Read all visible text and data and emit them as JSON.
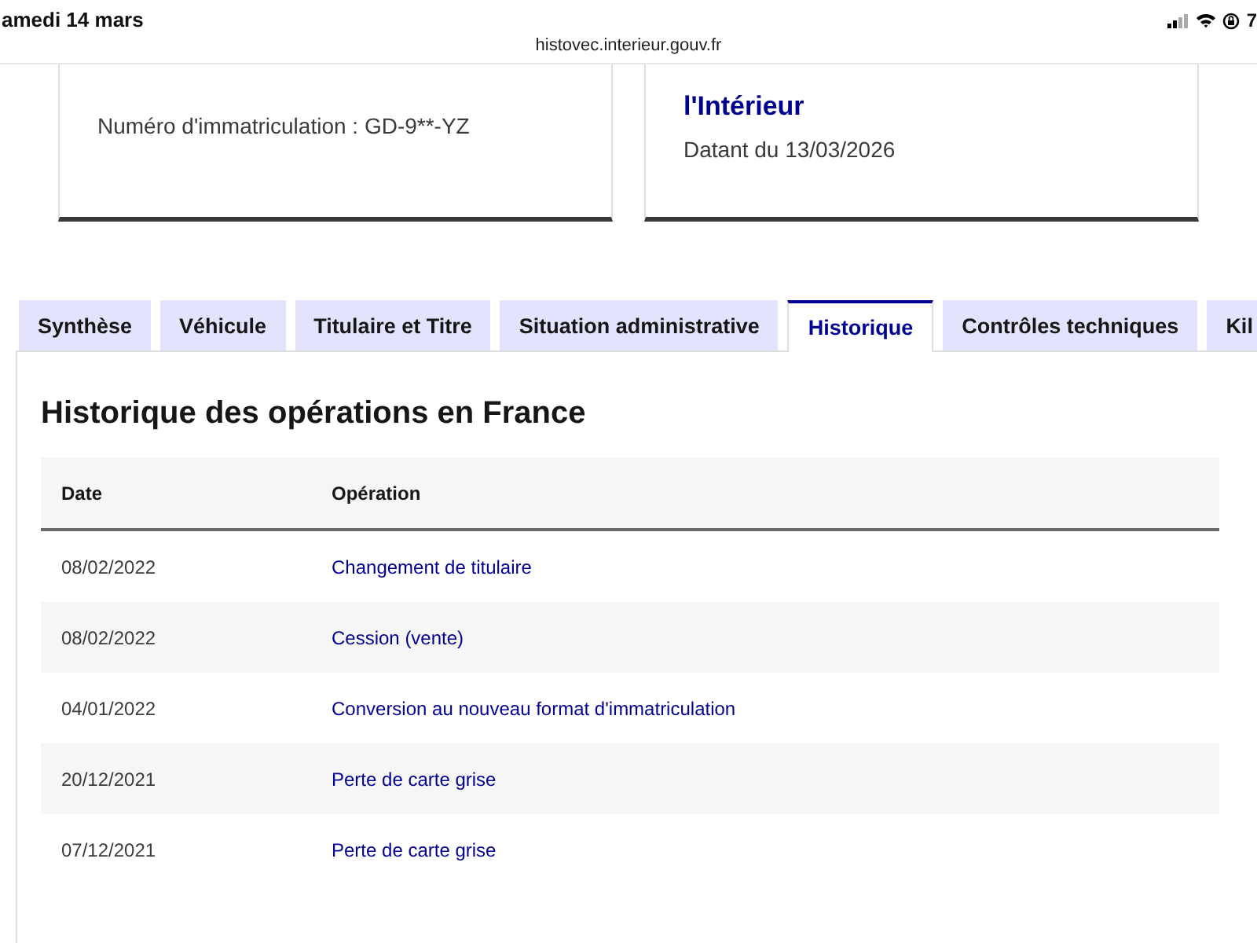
{
  "status_bar": {
    "date": "amedi 14 mars",
    "url": "histovec.interieur.gouv.fr",
    "battery": "7"
  },
  "cards": [
    {
      "detail": "Numéro d'immatriculation : GD-9**-YZ"
    },
    {
      "title": "l'Intérieur",
      "detail": "Datant du 13/03/2026"
    }
  ],
  "tabs": [
    {
      "label": "Synthèse",
      "selected": false
    },
    {
      "label": "Véhicule",
      "selected": false
    },
    {
      "label": "Titulaire et Titre",
      "selected": false
    },
    {
      "label": "Situation administrative",
      "selected": false
    },
    {
      "label": "Historique",
      "selected": true
    },
    {
      "label": "Contrôles techniques",
      "selected": false
    },
    {
      "label": "Kil",
      "selected": false
    }
  ],
  "section": {
    "heading": "Historique des opérations en France",
    "table": {
      "columns": [
        "Date",
        "Opération"
      ],
      "rows": [
        [
          "08/02/2022",
          "Changement de titulaire"
        ],
        [
          "08/02/2022",
          "Cession (vente)"
        ],
        [
          "04/01/2022",
          "Conversion au nouveau format d'immatriculation"
        ],
        [
          "20/12/2021",
          "Perte de carte grise"
        ],
        [
          "07/12/2021",
          "Perte de carte grise"
        ]
      ]
    }
  }
}
